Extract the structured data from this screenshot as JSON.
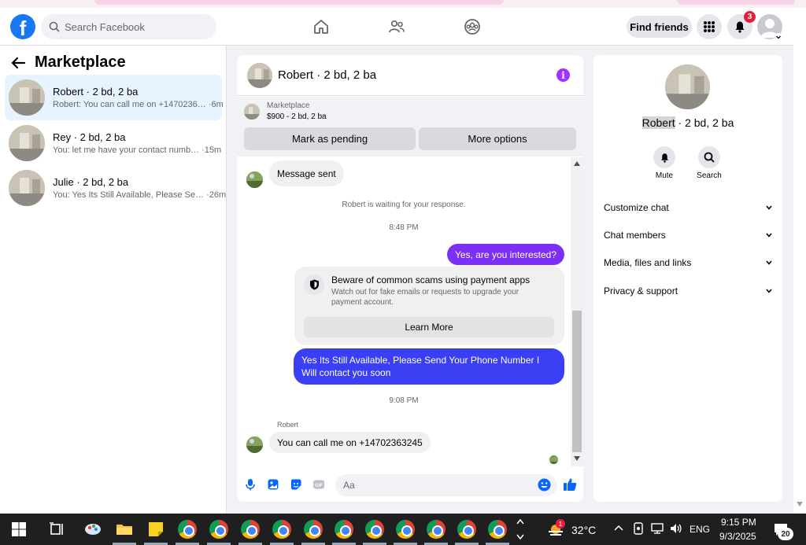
{
  "topbar": {
    "logo": "f",
    "search_placeholder": "Search Facebook",
    "find_friends": "Find friends",
    "notification_count": "3"
  },
  "left": {
    "title": "Marketplace",
    "conversations": [
      {
        "name": "Robert · 2 bd, 2 ba",
        "preview": "Robert: You can call me on +1470236… ·6m",
        "active": true
      },
      {
        "name": "Rey · 2 bd, 2 ba",
        "preview": "You: let me have your contact numb… ·15m",
        "active": false
      },
      {
        "name": "Julie · 2 bd, 2 ba",
        "preview": "You: Yes Its Still Available, Please Se… ·26m",
        "active": false
      }
    ]
  },
  "chat": {
    "title": "Robert · 2 bd, 2 ba",
    "marketplace_label": "Marketplace",
    "listing": "$900 - 2 bd, 2 ba",
    "mark_pending": "Mark as pending",
    "more_options": "More options",
    "messages": {
      "sent_notice": "Message sent",
      "waiting": "Robert is waiting for your response.",
      "time1": "8:48 PM",
      "out1": "Yes, are you interested?",
      "scam_title": "Beware of common scams using payment apps",
      "scam_text": "Watch out for fake emails or requests to upgrade your payment account.",
      "learn_more": "Learn More",
      "out2": "Yes Its Still Available, Please Send Your Phone Number I Will contact you soon",
      "time2": "9:08 PM",
      "sender": "Robert",
      "in1": "You can call me on +14702363245"
    },
    "composer_placeholder": "Aa"
  },
  "right": {
    "name_highlight": "Robert",
    "name_rest": " · 2 bd, 2 ba",
    "mute": "Mute",
    "search": "Search",
    "sections": [
      "Customize chat",
      "Chat members",
      "Media, files and links",
      "Privacy & support"
    ]
  },
  "taskbar": {
    "weather_badge": "1",
    "temperature": "32°C",
    "language": "ENG",
    "time": "9:15 PM",
    "date": "9/3/2025",
    "notif_count": "20"
  },
  "colors": {
    "brand": "#1877f2",
    "outgoing_purple": "#7b2ff7",
    "outgoing_blue": "#3a3ff4",
    "badge": "#e41e3f"
  }
}
